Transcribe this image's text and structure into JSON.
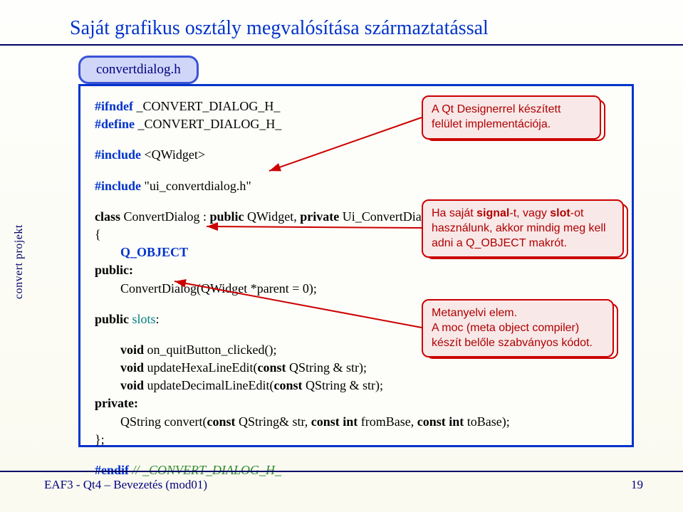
{
  "title": "Saját grafikus osztály megvalósítása származtatással",
  "sidebar": "convert projekt",
  "file_tab": "convertdialog.h",
  "code": {
    "l1a": "#ifndef",
    "l1b": " _CONVERT_DIALOG_H_",
    "l2a": "#define",
    "l2b": " _CONVERT_DIALOG_H_",
    "l3a": "#include",
    "l3b": " <QWidget>",
    "l4a": "#include",
    "l4b": " \"ui_convertdialog.h\"",
    "l5a": "class",
    "l5b": " ConvertDialog : ",
    "l5c": "public",
    "l5d": " QWidget, ",
    "l5e": "private",
    "l5f": " Ui_ConvertDialog",
    "l6": "{",
    "l7": "        Q_OBJECT",
    "l8": "public:",
    "l9": "        ConvertDialog(QWidget *parent = 0);",
    "l10a": "public ",
    "l10b": "slots",
    "l10c": ":",
    "l11a": "        void",
    "l11b": " on_quitButton_clicked();",
    "l12a": "        void",
    "l12b": " updateHexaLineEdit(",
    "l12c": "const",
    "l12d": " QString & str);",
    "l13a": "        void",
    "l13b": " updateDecimalLineEdit(",
    "l13c": "const",
    "l13d": " QString & str);",
    "l14": "private:",
    "l15a": "        QString convert(",
    "l15b": "const",
    "l15c": " QString& str, ",
    "l15d": "const int",
    "l15e": " fromBase, ",
    "l15f": "const int",
    "l15g": " toBase);",
    "l16": "};",
    "l17a": "#endif",
    "l17b": " // _CONVERT_DIALOG_H_"
  },
  "callout1": {
    "line1": "A Qt Designerrel készített",
    "line2": "felület implementációja."
  },
  "callout2": {
    "line1a": "Ha saját ",
    "line1b": "signal",
    "line1c": "-t, vagy ",
    "line1d": "slot",
    "line1e": "-ot",
    "line2": "használunk, akkor mindig meg kell",
    "line3": "adni a Q_OBJECT makrót."
  },
  "callout3": {
    "line1": "Metanyelvi elem.",
    "line2": "A moc (meta object compiler)",
    "line3": "készít belőle szabványos kódot."
  },
  "footer": {
    "left": "EAF3 - Qt4 – Bevezetés (mod01)",
    "right": "19"
  }
}
